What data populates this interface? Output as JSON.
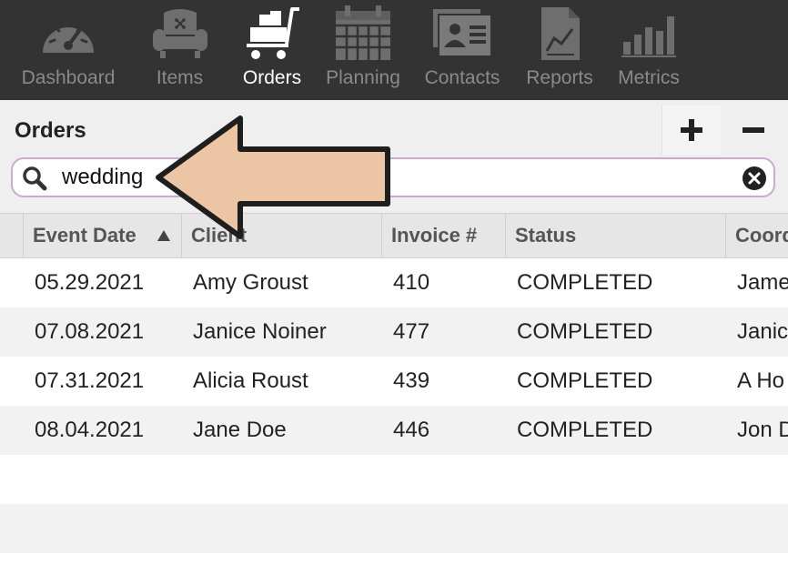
{
  "nav": {
    "items": [
      {
        "label": "Dashboard",
        "icon": "dashboard-gauge-icon"
      },
      {
        "label": "Items",
        "icon": "armchair-icon"
      },
      {
        "label": "Orders",
        "icon": "cart-icon",
        "active": true
      },
      {
        "label": "Planning",
        "icon": "calendar-icon"
      },
      {
        "label": "Contacts",
        "icon": "contact-card-icon"
      },
      {
        "label": "Reports",
        "icon": "report-chart-icon"
      },
      {
        "label": "Metrics",
        "icon": "bar-chart-icon"
      }
    ]
  },
  "header": {
    "title": "Orders",
    "add_icon": "plus-icon",
    "remove_icon": "minus-icon"
  },
  "search": {
    "value": "wedding"
  },
  "table": {
    "columns": [
      "Event Date",
      "Client",
      "Invoice #",
      "Status",
      "Coord"
    ],
    "sort": {
      "column": "Event Date",
      "direction": "ascending"
    },
    "rows": [
      [
        "05.29.2021",
        "Amy Groust",
        "410",
        "COMPLETED",
        "Jame"
      ],
      [
        "07.08.2021",
        "Janice Noiner",
        "477",
        "COMPLETED",
        "Janic"
      ],
      [
        "07.31.2021",
        "Alicia Roust",
        "439",
        "COMPLETED",
        "A Ho"
      ],
      [
        "08.04.2021",
        "Jane Doe",
        "446",
        "COMPLETED",
        "Jon D"
      ]
    ]
  },
  "annotation": {
    "arrow_color": "#ecc6a4",
    "arrow_direction": "left"
  },
  "colors": {
    "nav_bg": "#333333",
    "search_border": "#c9a9d6",
    "header_bg": "#efefef"
  }
}
